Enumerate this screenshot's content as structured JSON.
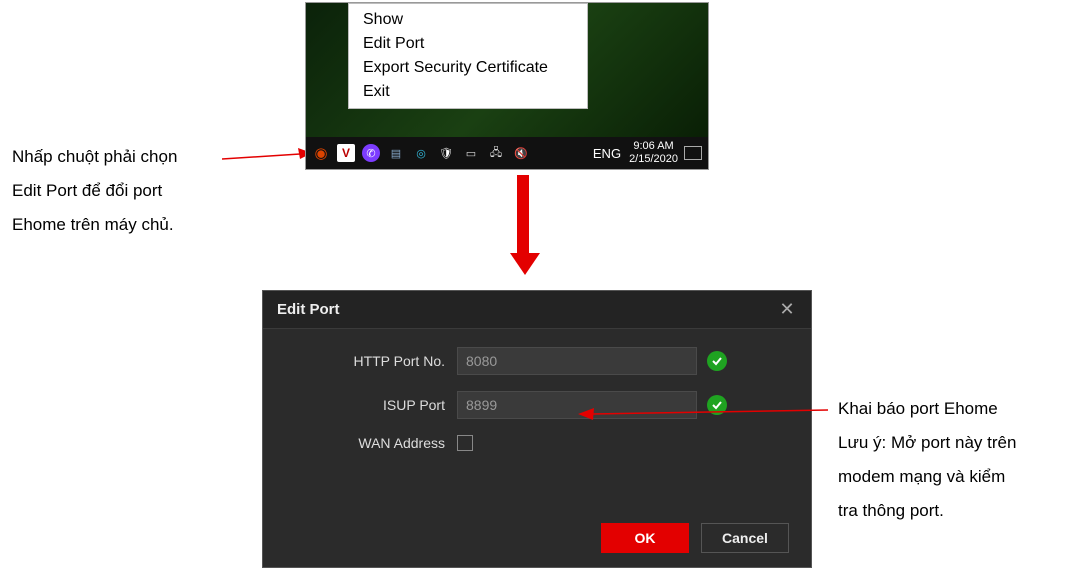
{
  "annotations": {
    "left_line1": "Nhấp chuột phải chọn",
    "left_line2": "Edit Port để đổi port",
    "left_line3": "Ehome trên máy chủ.",
    "right_line1": "Khai báo port Ehome",
    "right_line2": "Lưu ý: Mở port này trên",
    "right_line3": "modem mạng và kiểm",
    "right_line4": "tra thông port."
  },
  "context_menu": {
    "items": [
      "Show",
      "Edit Port",
      "Export Security Certificate",
      "Exit"
    ]
  },
  "taskbar": {
    "lang": "ENG",
    "time": "9:06 AM",
    "date": "2/15/2020"
  },
  "dialog": {
    "title": "Edit Port",
    "http_label": "HTTP Port No.",
    "http_value": "8080",
    "isup_label": "ISUP Port",
    "isup_value": "8899",
    "wan_label": "WAN Address",
    "ok_label": "OK",
    "cancel_label": "Cancel"
  }
}
